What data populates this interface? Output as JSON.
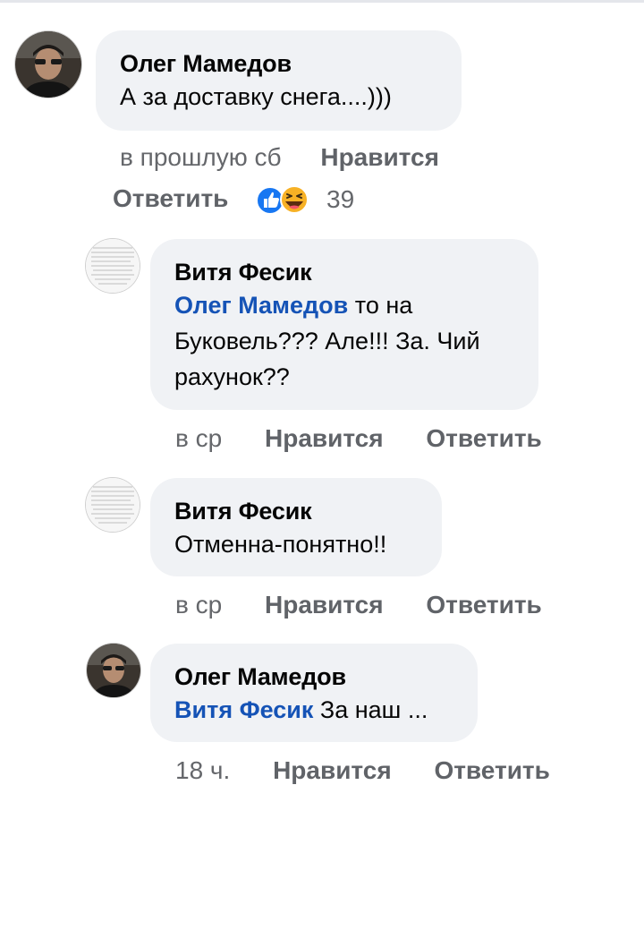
{
  "comments": [
    {
      "author": "Олег Мамедов",
      "mention": "",
      "text": "А за доставку снега....)))",
      "time": "в прошлую сб",
      "like_label": "Нравится",
      "reply_label": "Ответить",
      "reactions": {
        "icons": [
          "like-icon",
          "haha-icon"
        ],
        "count": "39"
      }
    },
    {
      "author": "Витя Фесик",
      "mention": "Олег Мамедов",
      "text_line1": " то на",
      "text_line2": "Буковель??? Але!!! За. Чий",
      "text_line3": "рахунок??",
      "time": "в ср",
      "like_label": "Нравится",
      "reply_label": "Ответить"
    },
    {
      "author": "Витя Фесик",
      "text": "Отменна-понятно!!",
      "time": "в ср",
      "like_label": "Нравится",
      "reply_label": "Ответить"
    },
    {
      "author": "Олег Мамедов",
      "mention": "Витя Фесик",
      "text": " За наш ...",
      "time": "18 ч.",
      "like_label": "Нравится",
      "reply_label": "Ответить"
    }
  ],
  "colors": {
    "bubble": "#f0f2f5",
    "mention": "#1553b6",
    "meta": "#65676b",
    "like_reaction": "#1877f2",
    "haha_reaction": "#f7b125"
  }
}
